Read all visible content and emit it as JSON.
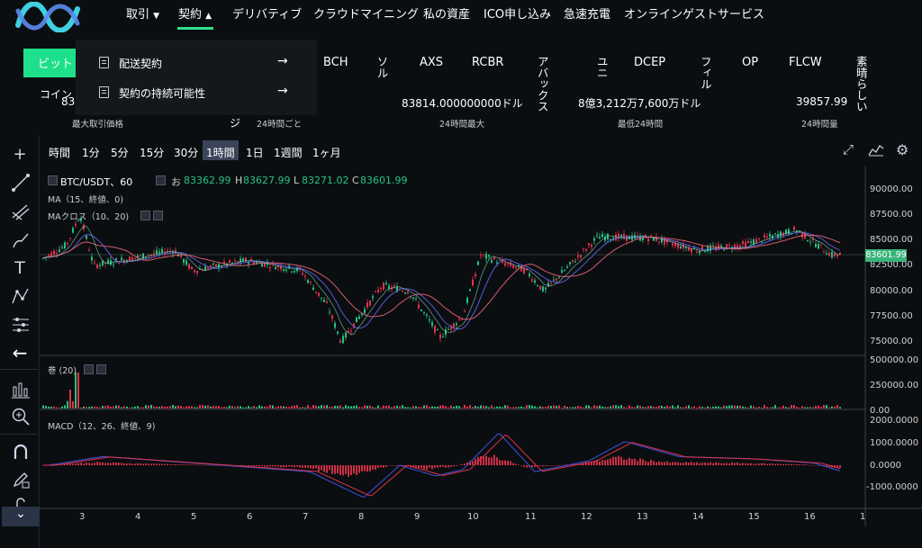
{
  "nav": {
    "items": [
      "取引",
      "契約",
      "デリバティブ",
      "クラウドマイニング",
      "私の資産",
      "ICO申し込み",
      "急速充電",
      "オンラインゲストサービス"
    ]
  },
  "dropdown": {
    "items": [
      "配送契約",
      "契約の持続可能性"
    ],
    "arrow": "→"
  },
  "ticker": {
    "active": "ビット",
    "items": [
      "BCH",
      "ソル",
      "AXS",
      "RCBR",
      "アバックス",
      "ユニ",
      "DCEP",
      "フィル",
      "OP",
      "FLCW",
      "素晴らしい"
    ]
  },
  "stats": {
    "prefix": "コイン",
    "price_partial": "83",
    "ji": "ジ",
    "high_value": "83814.000000000ドル",
    "low_value": "8億3,212万7,600万ドル",
    "volume_value": "39857.99",
    "labels": [
      "最大取引価格",
      "24時間ごと",
      "24時間最大",
      "最低24時間",
      "24時間量"
    ]
  },
  "timeframes": [
    "時間",
    "1分",
    "5分",
    "15分",
    "30分",
    "1時間",
    "1日",
    "1週間",
    "1ヶ月"
  ],
  "chart": {
    "symbol": "BTC/USDT、60",
    "o_label": "お",
    "o_val": "83362.99",
    "h_label": "H",
    "h_val": "83627.99",
    "l_label": "L",
    "l_val": "83271.02",
    "c_label": "C",
    "c_val": "83601.99",
    "ma": "MA（15、終値、0)",
    "macross": "MAクロス（10、20)",
    "vol": "巻 (20)",
    "macd": "MACD（12、26、終値、9)",
    "last_price": "83601.99",
    "price_ticks": [
      "90000.00",
      "87500.00",
      "85000.00",
      "82500.00",
      "80000.00",
      "77500.00",
      "75000.00"
    ],
    "vol_ticks": [
      "500000.00",
      "250000.00",
      "0.00"
    ],
    "macd_ticks": [
      "2000.0000",
      "1000.0000",
      "0.0000",
      "-1000.0000"
    ],
    "x_ticks": [
      "3",
      "4",
      "5",
      "6",
      "7",
      "8",
      "9",
      "10",
      "11",
      "12",
      "13",
      "14",
      "15",
      "16",
      "1"
    ],
    "colors": {
      "up": "#26c281",
      "down": "#e0334a",
      "accent": "#1ee08a"
    }
  }
}
